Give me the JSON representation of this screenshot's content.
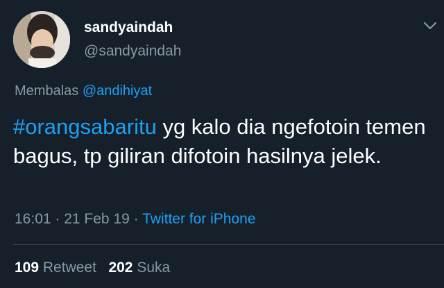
{
  "user": {
    "display_name": "sandyaindah",
    "handle": "@sandyaindah"
  },
  "reply": {
    "prefix": "Membalas ",
    "mention": "@andihiyat"
  },
  "tweet": {
    "hashtag": "#orangsabaritu",
    "text": " yg kalo dia ngefotoin temen bagus, tp giliran difotoin hasilnya jelek."
  },
  "meta": {
    "time": "16:01",
    "sep1": " · ",
    "date": "21 Feb 19",
    "sep2": " · ",
    "source": "Twitter for iPhone"
  },
  "stats": {
    "retweets_count": "109",
    "retweets_label": "Retweet",
    "likes_count": "202",
    "likes_label": "Suka"
  },
  "icons": {
    "menu": "chevron-down-icon"
  },
  "colors": {
    "background": "#15202b",
    "link": "#1da1f2",
    "secondary_text": "#8899a6"
  }
}
